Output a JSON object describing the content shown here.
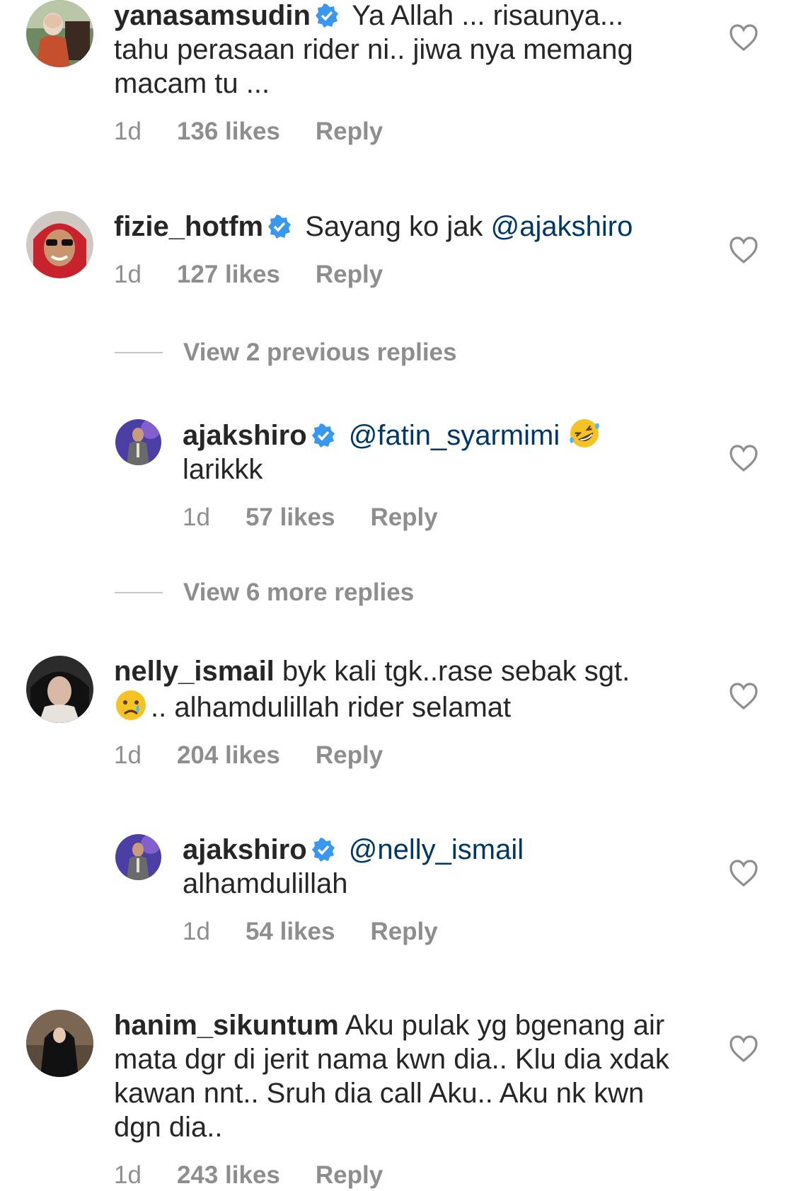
{
  "comments": [
    {
      "username": "yanasamsudin",
      "text": "Ya Allah ... risaunya... tahu perasaan rider ni.. jiwa nya memang macam tu ...",
      "time": "1d",
      "likes": "136 likes",
      "reply": "Reply",
      "verified": true,
      "avatar_icon": "profile-photo-woman-hijab-orange"
    },
    {
      "username": "fizie_hotfm",
      "text": "Sayang ko jak",
      "mention": "@ajakshiro",
      "time": "1d",
      "likes": "127 likes",
      "reply": "Reply",
      "verified": true,
      "avatar_icon": "profile-photo-man-red-hood-sunglasses"
    },
    {
      "username": "nelly_ismail",
      "text_line1": "byk kali tgk..rase sebak sgt.",
      "emoji": "crying-face-emoji",
      "text_line2": ".. alhamdulillah rider selamat",
      "time": "1d",
      "likes": "204 likes",
      "reply": "Reply",
      "verified": false,
      "avatar_icon": "profile-photo-woman-hijab-dark"
    },
    {
      "username": "hanim_sikuntum",
      "text": "Aku pulak yg bgenang air mata dgr di jerit nama kwn dia.. Klu dia xdak kawan nnt.. Sruh dia call Aku.. Aku nk kwn dgn dia..",
      "time": "1d",
      "likes": "243 likes",
      "reply": "Reply",
      "verified": false,
      "avatar_icon": "profile-photo-woman-black-abaya"
    }
  ],
  "view_previous_replies": "View 2 previous replies",
  "view_more_replies": "View 6 more replies",
  "replies": [
    {
      "username": "ajakshiro",
      "mention": "@fatin_syarmimi",
      "emoji": "rolling-on-floor-laughing-emoji",
      "text": "larikkk",
      "time": "1d",
      "likes": "57 likes",
      "reply": "Reply",
      "verified": true,
      "avatar_icon": "profile-photo-man-stage-purple"
    },
    {
      "username": "ajakshiro",
      "mention": "@nelly_ismail",
      "text": "alhamdulillah",
      "time": "1d",
      "likes": "54 likes",
      "reply": "Reply",
      "verified": true,
      "avatar_icon": "profile-photo-man-stage-purple"
    }
  ],
  "colors": {
    "text": "#262626",
    "meta": "#8e8e8e",
    "mention": "#00376b",
    "verified": "#3897f0"
  }
}
